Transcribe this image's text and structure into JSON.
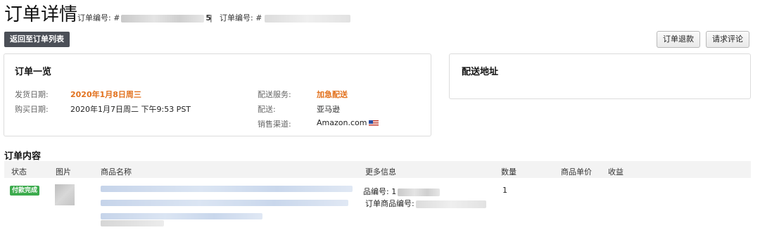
{
  "header": {
    "title": "订单详情",
    "order_label_1": "订单编号: #",
    "order_suffix_1": "5",
    "order_label_2": "订单编号: #",
    "separator": "|"
  },
  "actions": {
    "back_label": "返回至订单列表",
    "refund_label": "订单退款",
    "review_label": "请求评论"
  },
  "overview": {
    "title": "订单一览",
    "ship_date_label": "发货日期:",
    "ship_date_value": "2020年1月8日周三",
    "purchase_date_label": "购买日期:",
    "purchase_date_value": "2020年1月7日周二 下午9:53 PST",
    "service_label": "配送服务:",
    "service_value": "加急配送",
    "shipping_label": "配送:",
    "shipping_value": "亚马逊",
    "channel_label": "销售渠道:",
    "channel_value": "Amazon.com",
    "channel_flag_icon": "us-flag-icon"
  },
  "address": {
    "title": "配送地址"
  },
  "contents": {
    "title": "订单内容",
    "columns": [
      "状态",
      "图片",
      "商品名称",
      "更多信息",
      "数量",
      "商品单价",
      "收益"
    ],
    "rows": [
      {
        "status": "付款完成",
        "status_color": "#3cab4d",
        "more_info_line1": "品编号: 1",
        "more_info_line2": "订单商品编号:",
        "quantity": "1"
      }
    ]
  }
}
